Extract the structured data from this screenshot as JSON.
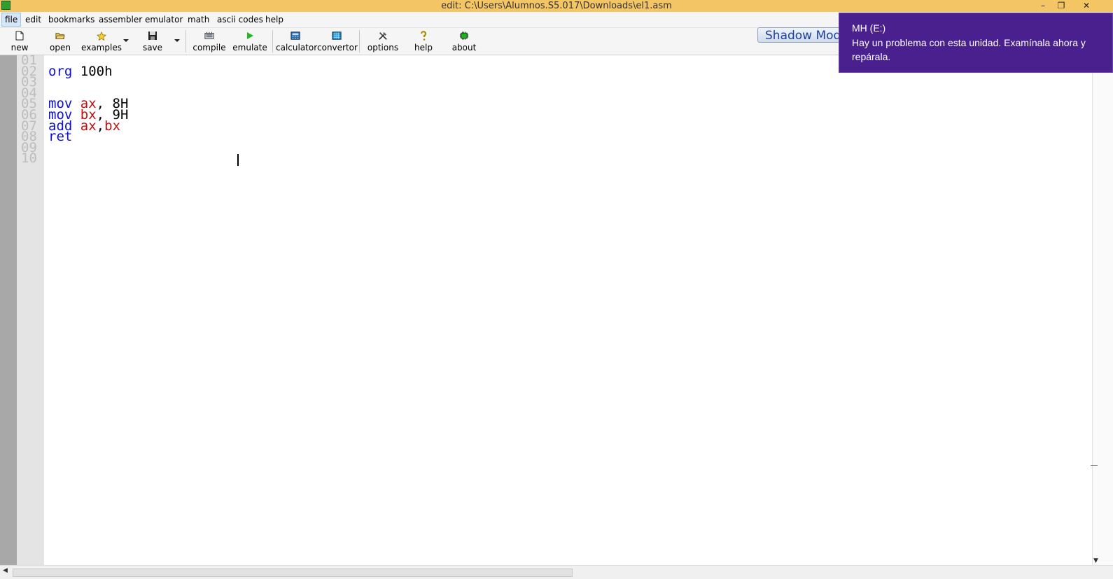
{
  "window": {
    "title": "edit: C:\\Users\\Alumnos.S5.017\\Downloads\\el1.asm",
    "minimize_glyph": "–",
    "restore_glyph": "❐",
    "close_glyph": "✕"
  },
  "menu": {
    "items": [
      "file",
      "edit",
      "bookmarks",
      "assembler",
      "emulator",
      "math",
      "ascii codes",
      "help"
    ]
  },
  "toolbar": {
    "buttons": [
      {
        "label": "new",
        "icon": "new-file-icon"
      },
      {
        "label": "open",
        "icon": "folder-open-icon"
      },
      {
        "label": "examples",
        "icon": "star-icon"
      },
      {
        "label": "save",
        "icon": "floppy-disk-icon"
      },
      {
        "label": "compile",
        "icon": "compile-icon"
      },
      {
        "label": "emulate",
        "icon": "play-icon"
      },
      {
        "label": "calculator",
        "icon": "calculator-icon"
      },
      {
        "label": "convertor",
        "icon": "convertor-icon"
      },
      {
        "label": "options",
        "icon": "tools-icon"
      },
      {
        "label": "help",
        "icon": "question-icon"
      },
      {
        "label": "about",
        "icon": "chip-icon"
      }
    ],
    "shadow_mode_label": "Shadow Mode"
  },
  "editor": {
    "line_numbers": [
      "01",
      "02",
      "03",
      "04",
      "05",
      "06",
      "07",
      "08",
      "09",
      "10"
    ],
    "code": {
      "line2": {
        "kw": "org",
        "rest": " 100h"
      },
      "line5": {
        "kw": "mov",
        "reg": "ax",
        "rest": ", 8H"
      },
      "line6": {
        "kw": "mov",
        "reg": "bx",
        "rest": ", 9H"
      },
      "line7": {
        "kw": "add",
        "reg1": "ax",
        "sep": ",",
        "reg2": "bx"
      },
      "line8": {
        "kw": "ret"
      }
    }
  },
  "notification": {
    "title": "MH (E:)",
    "body": "Hay un problema con esta unidad. Examínala ahora y repárala."
  },
  "colors": {
    "titlebar": "#f3c565",
    "toast": "#4a208f",
    "keyword": "#1010d0",
    "register": "#c01010"
  }
}
